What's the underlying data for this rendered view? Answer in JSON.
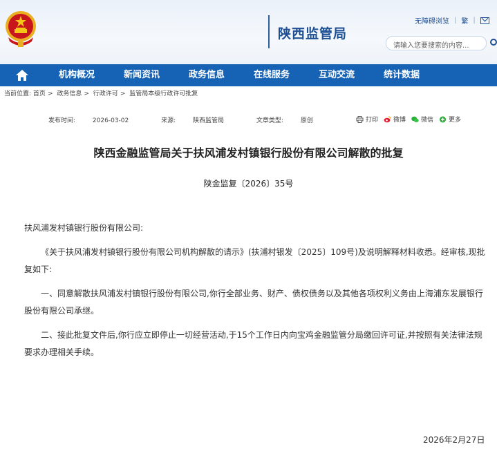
{
  "header": {
    "site_name": "陕西监管局",
    "accessibility_label": "无障碍浏览",
    "language_label": "繁",
    "search_placeholder": "请输入您要搜索的内容..."
  },
  "nav": {
    "items": [
      {
        "label": "机构概况"
      },
      {
        "label": "新闻资讯"
      },
      {
        "label": "政务信息"
      },
      {
        "label": "在线服务"
      },
      {
        "label": "互动交流"
      },
      {
        "label": "统计数据"
      }
    ]
  },
  "breadcrumb": {
    "prefix": "当前位置:",
    "items": [
      "首页",
      "政务信息",
      "行政许可",
      "监管局本级行政许可批复"
    ]
  },
  "article": {
    "publish_label": "发布时间:",
    "publish_date": "2026-03-02",
    "source_label": "来源:",
    "source": "陕西监管局",
    "type_label": "文章类型:",
    "type": "原创",
    "share": {
      "print": "打印",
      "weibo": "微博",
      "wechat": "微信",
      "more": "更多"
    },
    "title": "陕西金融监管局关于扶风浦发村镇银行股份有限公司解散的批复",
    "doc_number": "陕金监复〔2026〕35号",
    "addressee": "扶风浦发村镇银行股份有限公司:",
    "paragraphs": [
      "《关于扶风浦发村镇银行股份有限公司机构解散的请示》(扶浦村银发〔2025〕109号)及说明解释材料收悉。经审核,现批复如下:",
      "一、同意解散扶风浦发村镇银行股份有限公司,你行全部业务、财产、债权债务以及其他各项权利义务由上海浦东发展银行股份有限公司承继。",
      "二、接此批复文件后,你行应立即停止一切经营活动,于15个工作日内向宝鸡金融监管分局缴回许可证,并按照有关法律法规要求办理相关手续。"
    ],
    "sign_date": "2026年2月27日"
  }
}
